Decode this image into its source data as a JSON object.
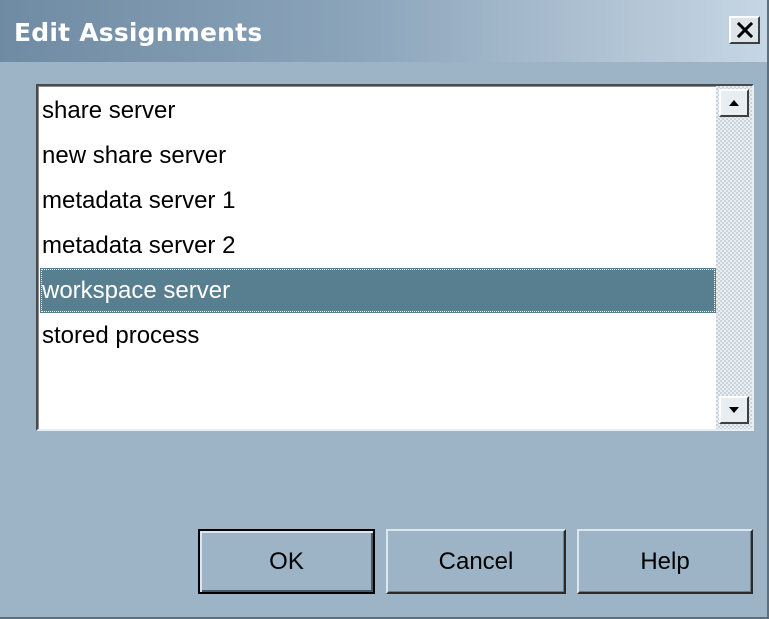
{
  "window": {
    "title": "Edit Assignments",
    "close_icon": "close-icon"
  },
  "assignments": {
    "items": [
      {
        "label": "share server"
      },
      {
        "label": "new share server"
      },
      {
        "label": "metadata server 1"
      },
      {
        "label": "metadata server 2"
      },
      {
        "label": "workspace server"
      },
      {
        "label": "stored process"
      }
    ],
    "selected_label": "workspace server",
    "scroll_up_icon": "arrow-up-icon",
    "scroll_down_icon": "arrow-down-icon"
  },
  "buttons": {
    "ok_label": "OK",
    "cancel_label": "Cancel",
    "help_label": "Help"
  },
  "colors": {
    "background": "#9db3c6",
    "selection": "#587f8f",
    "selection_text": "#ffffff"
  }
}
